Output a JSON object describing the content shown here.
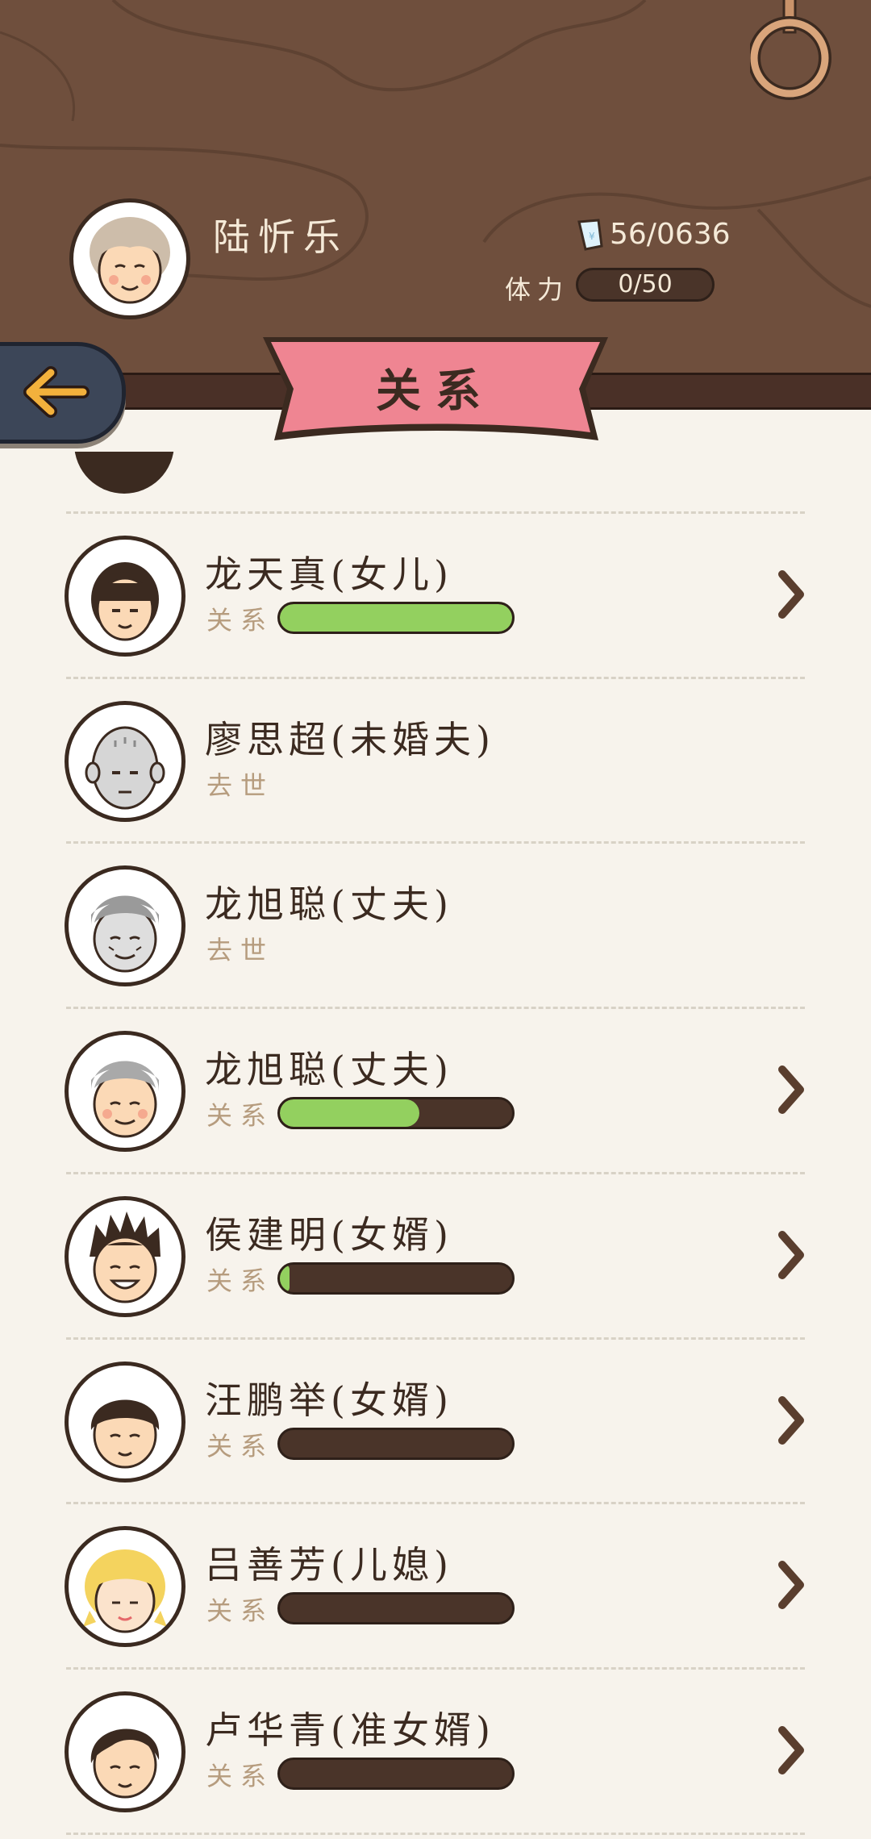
{
  "header": {
    "player_name": "陆忻乐",
    "money": "56/0636",
    "stamina_label": "体力",
    "stamina": "0/50",
    "page_title": "关系"
  },
  "relations": [
    {
      "name": "龙天真(女儿)",
      "status": "关系",
      "progress": 1.0,
      "navigable": true,
      "avatar": "girl-bangs"
    },
    {
      "name": "廖思超(未婚夫)",
      "status": "去世",
      "progress": null,
      "navigable": false,
      "avatar": "bald-gray"
    },
    {
      "name": "龙旭聪(丈夫)",
      "status": "去世",
      "progress": null,
      "navigable": false,
      "avatar": "old-gray"
    },
    {
      "name": "龙旭聪(丈夫)",
      "status": "关系",
      "progress": 0.6,
      "navigable": true,
      "avatar": "old-man"
    },
    {
      "name": "侯建明(女婿)",
      "status": "关系",
      "progress": 0.03,
      "navigable": true,
      "avatar": "spiky"
    },
    {
      "name": "汪鹏举(女婿)",
      "status": "关系",
      "progress": 0,
      "navigable": true,
      "avatar": "bowl"
    },
    {
      "name": "吕善芳(儿媳)",
      "status": "关系",
      "progress": 0,
      "navigable": true,
      "avatar": "blonde"
    },
    {
      "name": "卢华青(准女婿)",
      "status": "关系",
      "progress": 0,
      "navigable": true,
      "avatar": "side-part"
    }
  ],
  "colors": {
    "wood": "#6f4f3d",
    "banner": "#ef8592",
    "progress_fill": "#93d05f",
    "progress_track": "#4a3429",
    "back_button": "#3c4658",
    "arrow": "#f3b13c"
  },
  "icons": {
    "back": "arrow-left-icon",
    "money": "ticket-icon",
    "chevron": "chevron-right-icon",
    "hook": "hanging-ring-icon"
  }
}
